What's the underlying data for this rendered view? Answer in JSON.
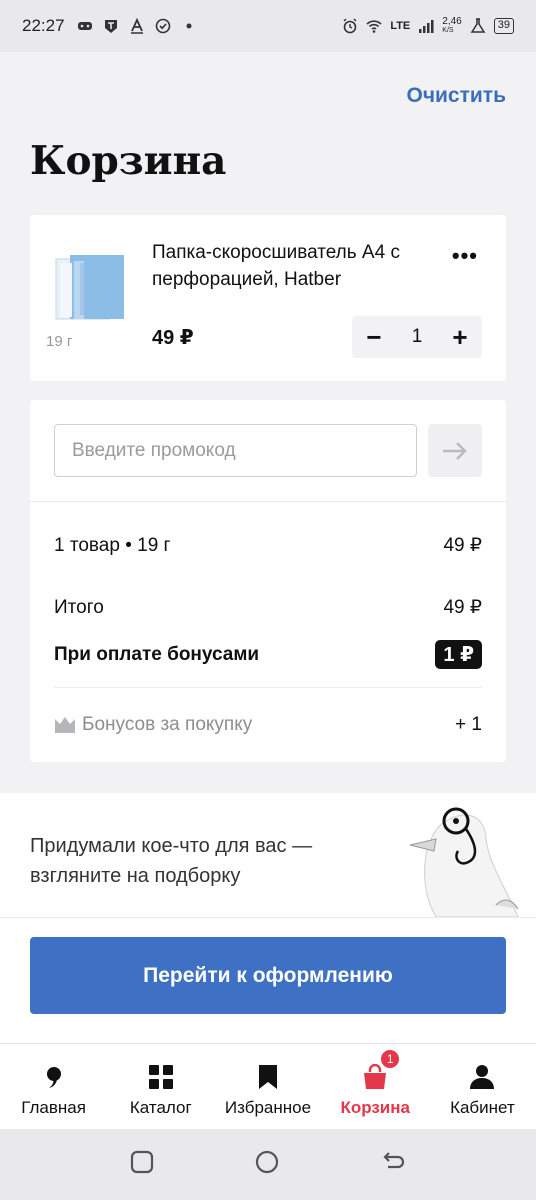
{
  "status_bar": {
    "time": "22:27",
    "network": "LTE",
    "speed": "2,46",
    "speed_unit": "K/S",
    "battery": "39"
  },
  "header": {
    "clear_label": "Очистить",
    "title": "Корзина"
  },
  "cart_item": {
    "title": "Папка-скоросшиватель А4 с перфорацией, Hatber",
    "weight": "19 г",
    "price": "49 ₽",
    "quantity": "1",
    "more_label": "•••",
    "minus_label": "−",
    "plus_label": "+"
  },
  "promo": {
    "placeholder": "Введите промокод"
  },
  "summary": {
    "items_label": "1 товар • 19 г",
    "items_value": "49 ₽",
    "total_label": "Итого",
    "total_value": "49 ₽",
    "bonus_pay_label": "При оплате бонусами",
    "bonus_pay_value": "1 ₽",
    "bonus_earn_label": "Бонусов за покупку",
    "bonus_earn_value": "+ 1"
  },
  "banner": {
    "text": "Придумали кое-что для вас — взгляните на подборку"
  },
  "checkout": {
    "label": "Перейти к оформлению"
  },
  "bottom_nav": {
    "items": [
      {
        "label": "Главная",
        "icon": "home-icon"
      },
      {
        "label": "Каталог",
        "icon": "catalog-icon"
      },
      {
        "label": "Избранное",
        "icon": "bookmark-icon"
      },
      {
        "label": "Корзина",
        "icon": "bag-icon",
        "badge": "1"
      },
      {
        "label": "Кабинет",
        "icon": "user-icon"
      }
    ]
  },
  "colors": {
    "accent": "#3e70c3",
    "link": "#3b6eb8",
    "active_nav": "#e4374a"
  }
}
